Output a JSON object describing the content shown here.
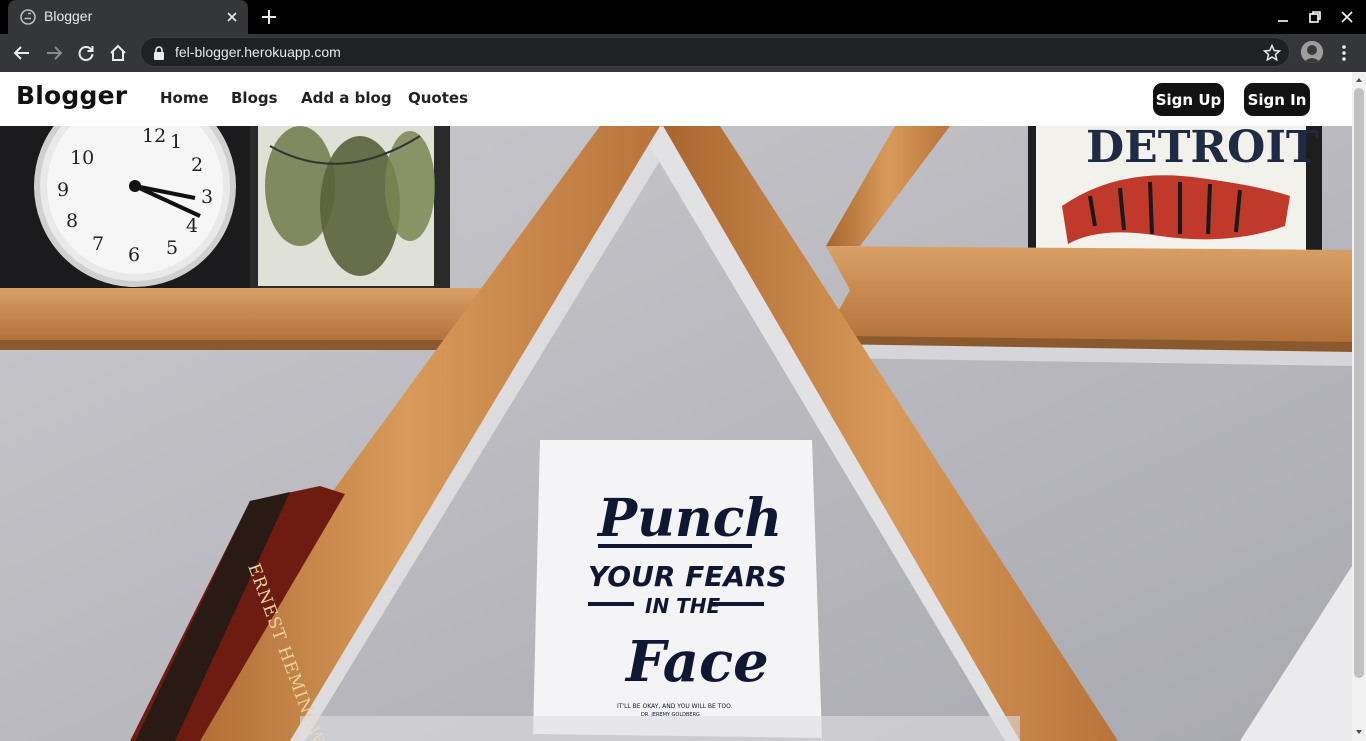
{
  "browser": {
    "tab_title": "Blogger",
    "url": "fel-blogger.herokuapp.com"
  },
  "site": {
    "brand": "Blogger",
    "nav": {
      "home": "Home",
      "blogs": "Blogs",
      "add_blog": "Add a blog",
      "quotes": "Quotes"
    },
    "sign_up": "Sign Up",
    "sign_in": "Sign In"
  },
  "hero": {
    "poster_line1": "Punch",
    "poster_line2": "YOUR FEARS",
    "poster_line3": "IN THE",
    "poster_line4": "Face",
    "poster_small": "IT'LL BE OKAY, AND YOU WILL BE TOO.",
    "poster_author": "DR. JEREMY GOLDBERG",
    "print_text": "DETROIT",
    "book_text": "ERNEST HEMINGWAY"
  },
  "colors": {
    "chrome_dark": "#35363a",
    "tabbar": "#000000",
    "button_bg": "#121212",
    "wall": "#b9b9bf",
    "wood": "#c98a4b"
  }
}
